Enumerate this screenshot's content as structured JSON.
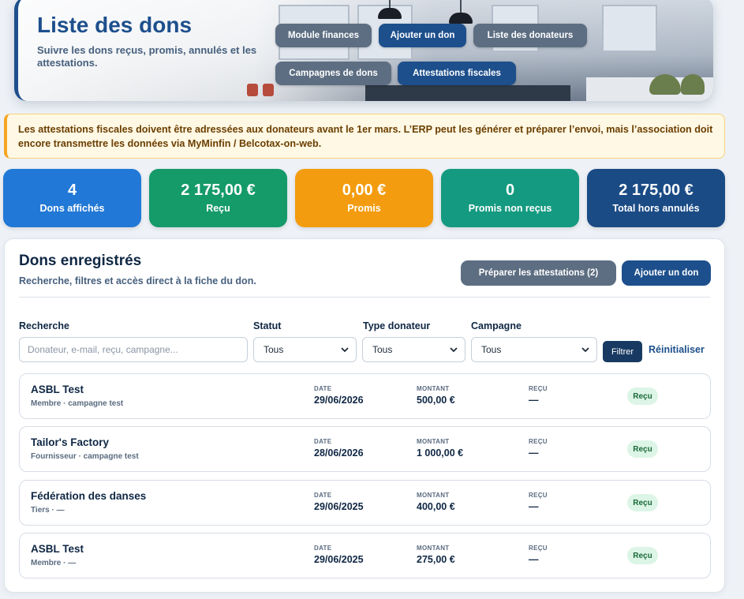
{
  "hero": {
    "title": "Liste des dons",
    "subtitle": "Suivre les dons reçus, promis, annulés et les attestations.",
    "buttons": [
      {
        "label": "Module finances"
      },
      {
        "label": "Ajouter un don"
      },
      {
        "label": "Liste des donateurs"
      },
      {
        "label": "Campagnes de dons"
      },
      {
        "label": "Attestations fiscales"
      }
    ]
  },
  "warning": {
    "text": "Les attestations fiscales doivent être adressées aux donateurs avant le 1er mars. L’ERP peut les générer et préparer l’envoi, mais l’association doit encore transmettre les données via MyMinfin / Belcotax-on-web."
  },
  "stats": [
    {
      "value": "4",
      "label": "Dons affichés",
      "color": "#2178d6"
    },
    {
      "value": "2 175,00 €",
      "label": "Reçu",
      "color": "#159a6a"
    },
    {
      "value": "0,00 €",
      "label": "Promis",
      "color": "#f39c0f"
    },
    {
      "value": "0",
      "label": "Promis non reçus",
      "color": "#149a80"
    },
    {
      "value": "2 175,00 €",
      "label": "Total hors annulés",
      "color": "#1a4b85"
    }
  ],
  "panel": {
    "title": "Dons enregistrés",
    "subtitle": "Recherche, filtres et accès direct à la fiche du don.",
    "prepare_label": "Préparer les attestations (2)",
    "add_label": "Ajouter un don"
  },
  "filters": {
    "search_label": "Recherche",
    "search_placeholder": "Donateur, e-mail, reçu, campagne...",
    "status_label": "Statut",
    "status_value": "Tous",
    "donor_type_label": "Type donateur",
    "donor_type_value": "Tous",
    "campaign_label": "Campagne",
    "campaign_value": "Tous",
    "filter_label": "Filtrer",
    "reset_label": "Réinitialiser"
  },
  "columns": {
    "date": "DATE",
    "amount": "MONTANT",
    "receipt": "REÇU"
  },
  "donations": [
    {
      "name": "ASBL Test",
      "meta": "Membre · campagne test",
      "date": "29/06/2026",
      "amount": "500,00 €",
      "receipt": "—",
      "status": "Reçu"
    },
    {
      "name": "Tailor's Factory",
      "meta": "Fournisseur · campagne test",
      "date": "28/06/2026",
      "amount": "1 000,00 €",
      "receipt": "—",
      "status": "Reçu"
    },
    {
      "name": "Fédération des danses",
      "meta": "Tiers · —",
      "date": "29/06/2025",
      "amount": "400,00 €",
      "receipt": "—",
      "status": "Reçu"
    },
    {
      "name": "ASBL Test",
      "meta": "Membre · —",
      "date": "29/06/2025",
      "amount": "275,00 €",
      "receipt": "—",
      "status": "Reçu"
    }
  ]
}
